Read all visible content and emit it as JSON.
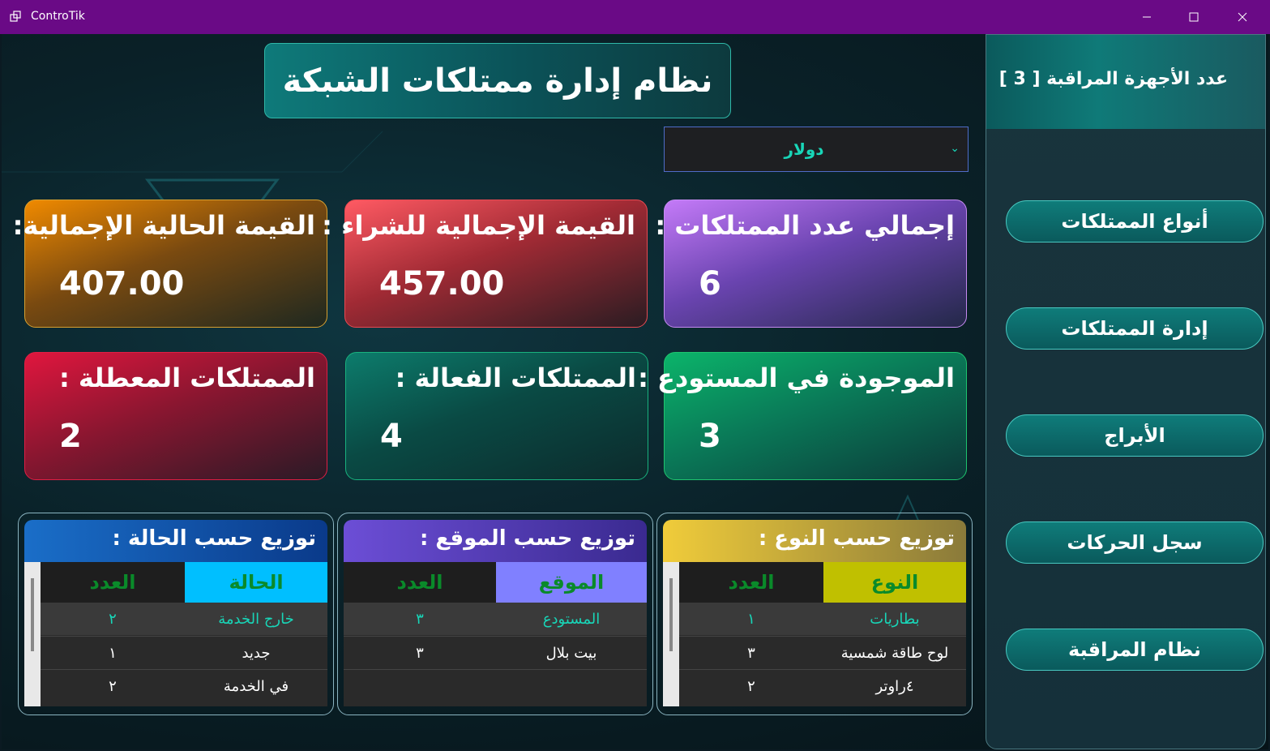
{
  "window": {
    "title": "ControTik"
  },
  "header": {
    "title": "نظام إدارة ممتلكات الشبكة"
  },
  "currency": {
    "selected": "دولار"
  },
  "cards": {
    "current_total_label": "القيمة الحالية الإجمالية:",
    "current_total_value": "407.00",
    "purchase_total_label": "القيمة الإجمالية للشراء :",
    "purchase_total_value": "457.00",
    "assets_total_label": "إجمالي عدد الممتلكات :",
    "assets_total_value": "6",
    "broken_label": "الممتلكات المعطلة :",
    "broken_value": "2",
    "active_label": "الممتلكات الفعالة :",
    "active_value": "4",
    "in_stock_label": "الموجودة في المستودع :",
    "in_stock_value": "3"
  },
  "tables": {
    "by_status": {
      "title": "توزيع حسب الحالة :",
      "col_key": "الحالة",
      "col_count": "العدد",
      "rows": [
        {
          "key": "خارج الخدمة",
          "count": "٢"
        },
        {
          "key": "جديد",
          "count": "١"
        },
        {
          "key": "في الخدمة",
          "count": "٢"
        }
      ]
    },
    "by_location": {
      "title": "توزيع حسب الموقع :",
      "col_key": "الموقع",
      "col_count": "العدد",
      "rows": [
        {
          "key": "المستودع",
          "count": "٣"
        },
        {
          "key": "بيت بلال",
          "count": "٣"
        }
      ]
    },
    "by_type": {
      "title": "توزيع حسب النوع :",
      "col_key": "النوع",
      "col_count": "العدد",
      "rows": [
        {
          "key": "بطاريات",
          "count": "١"
        },
        {
          "key": "لوح طاقة شمسية",
          "count": "٣"
        },
        {
          "key": "٤راوتر",
          "count": "٢"
        }
      ]
    }
  },
  "sidebar": {
    "monitored_count": "عدد الأجهزة المراقبة [ 3 ]",
    "items": [
      {
        "label": "أنواع الممتلكات"
      },
      {
        "label": "إدارة الممتلكات"
      },
      {
        "label": "الأبراج"
      },
      {
        "label": "سجل الحركات"
      },
      {
        "label": "نظام المراقبة"
      }
    ]
  },
  "colors": {
    "titlebar": "#6a0a86",
    "accent_teal": "#18d6b8",
    "status_header": "#00bfff",
    "location_header": "#8080ff",
    "type_header": "#c0c000",
    "count_header_text": "#0a8a2a"
  }
}
